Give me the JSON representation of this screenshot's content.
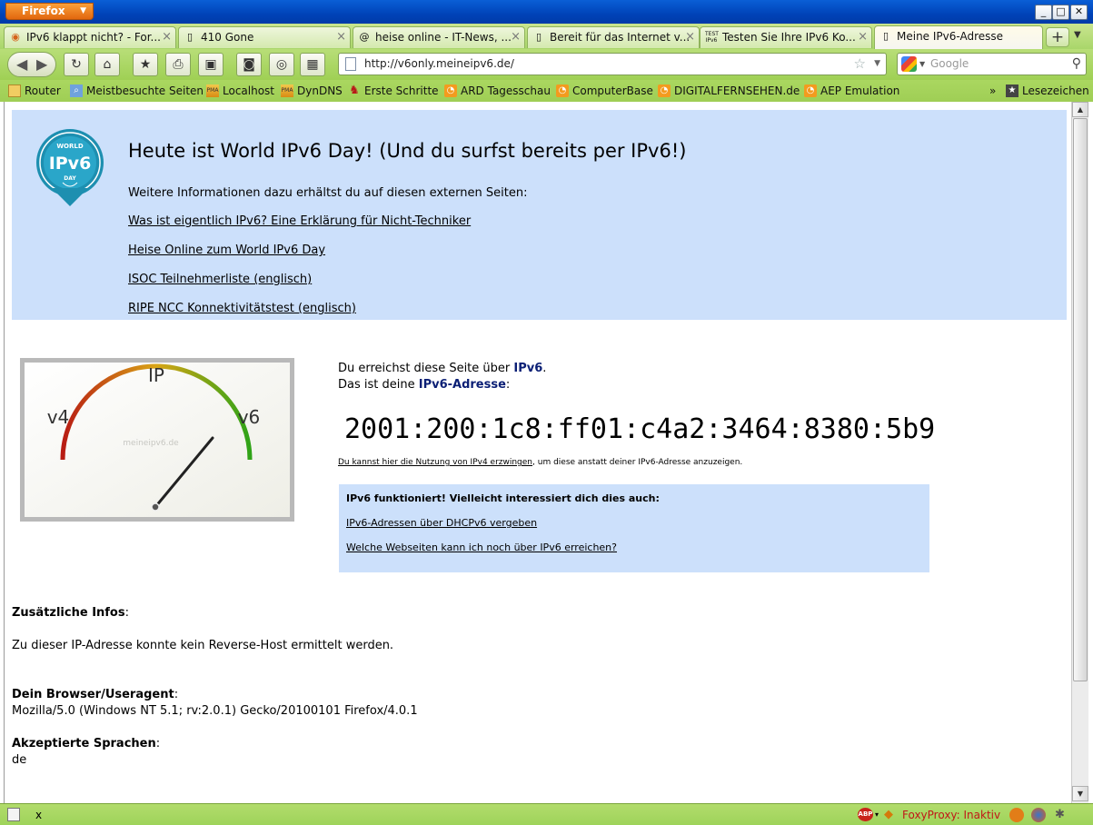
{
  "window": {
    "menu_button": "Firefox",
    "controls": [
      "_",
      "□",
      "✕"
    ]
  },
  "tabs": [
    {
      "label": "IPv6 klappt nicht? - For...",
      "icon": "forum-icon"
    },
    {
      "label": "410 Gone",
      "icon": "page-icon"
    },
    {
      "label": "heise online - IT-News, ...",
      "icon": "heise-icon"
    },
    {
      "label": "Bereit für das Internet v...",
      "icon": "page-icon"
    },
    {
      "label": "Testen Sie Ihre IPv6 Ko...",
      "icon": "test-ipv6-icon"
    },
    {
      "label": "Meine IPv6-Adresse",
      "icon": "page-icon",
      "active": true
    }
  ],
  "new_tab": "+",
  "nav": {
    "url": "http://v6only.meineipv6.de/",
    "search_placeholder": "Google"
  },
  "bookmarks": [
    {
      "label": "Router",
      "icon": "folder-icon"
    },
    {
      "label": "Meistbesuchte Seiten",
      "icon": "smart-folder-icon"
    },
    {
      "label": "Localhost",
      "icon": "pma-icon"
    },
    {
      "label": "DynDNS",
      "icon": "pma-icon"
    },
    {
      "label": "Erste Schritte",
      "icon": "firefox-icon"
    },
    {
      "label": "ARD Tagesschau",
      "icon": "rss-icon"
    },
    {
      "label": "ComputerBase",
      "icon": "rss-icon"
    },
    {
      "label": "DIGITALFERNSEHEN.de",
      "icon": "rss-icon"
    },
    {
      "label": "AEP Emulation",
      "icon": "rss-icon"
    }
  ],
  "bookmarks_overflow": "»",
  "bookmarks_menu": "Lesezeichen",
  "page": {
    "badge": {
      "top": "WORLD",
      "main": "IPv6",
      "bottom": "DAY"
    },
    "heading": "Heute ist World IPv6 Day! (Und du surfst bereits per IPv6!)",
    "intro": "Weitere Informationen dazu erhältst du auf diesen externen Seiten:",
    "links": [
      "Was ist eigentlich IPv6? Eine Erklärung für Nicht-Techniker",
      "Heise Online zum World IPv6 Day",
      "ISOC Teilnehmerliste (englisch)",
      "RIPE NCC Konnektivitätstest (englisch)"
    ],
    "gauge": {
      "top": "IP",
      "left": "v4",
      "right": "v6",
      "watermark": "meineipv6.de"
    },
    "reach_prefix": "Du erreichst diese Seite über ",
    "reach_proto": "IPv6",
    "reach_suffix": ".",
    "addr_prefix": "Das ist deine ",
    "addr_label": "IPv6-Adresse",
    "addr_suffix": ":",
    "ip_address": "2001:200:1c8:ff01:c4a2:3464:8380:5b9",
    "force_link": "Du kannst hier die Nutzung von IPv4 erzwingen",
    "force_rest": ", um diese anstatt deiner IPv6-Adresse anzuzeigen.",
    "more_title": "IPv6 funktioniert! Vielleicht interessiert dich dies auch:",
    "more_links": [
      "IPv6-Adressen über DHCPv6 vergeben",
      "Welche Webseiten kann ich noch über IPv6 erreichen?"
    ],
    "extra_label": "Zusätzliche Infos",
    "extra_text": "Zu dieser IP-Adresse konnte kein Reverse-Host ermittelt werden.",
    "ua_label": "Dein Browser/Useragent",
    "ua_text": "Mozilla/5.0 (Windows NT 5.1; rv:2.0.1) Gecko/20100101 Firefox/4.0.1",
    "lang_label": "Akzeptierte Sprachen",
    "lang_text": "de",
    "colon": ":"
  },
  "status": {
    "close": "x",
    "abp": "ABP",
    "foxyproxy": "FoxyProxy: Inaktiv"
  }
}
